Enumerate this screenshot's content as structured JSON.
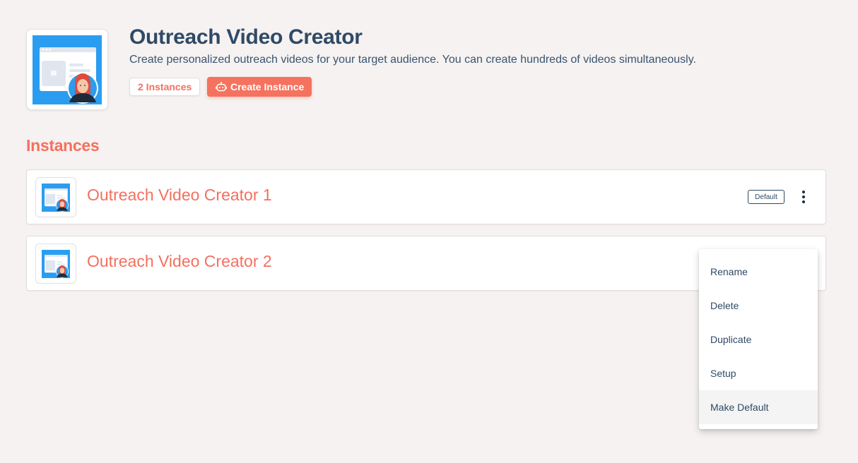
{
  "header": {
    "title": "Outreach Video Creator",
    "description": "Create personalized outreach videos for your target audience. You can create hundreds of videos simultaneously.",
    "instances_badge": "2 Instances",
    "create_button": "Create Instance"
  },
  "section": {
    "title": "Instances"
  },
  "instances": [
    {
      "name": "Outreach Video Creator 1",
      "badge": "Default"
    },
    {
      "name": "Outreach Video Creator 2"
    }
  ],
  "menu": {
    "items": [
      "Rename",
      "Delete",
      "Duplicate",
      "Setup",
      "Make Default"
    ],
    "hovered": "Make Default"
  },
  "colors": {
    "accent": "#f5725f",
    "text": "#2f4a66",
    "background": "#f5f2f1",
    "logo_blue": "#2b9df0"
  },
  "icons": {
    "app_logo": "video-creator-illustration",
    "create_button": "robot-icon",
    "card_menu": "kebab-menu-icon"
  }
}
